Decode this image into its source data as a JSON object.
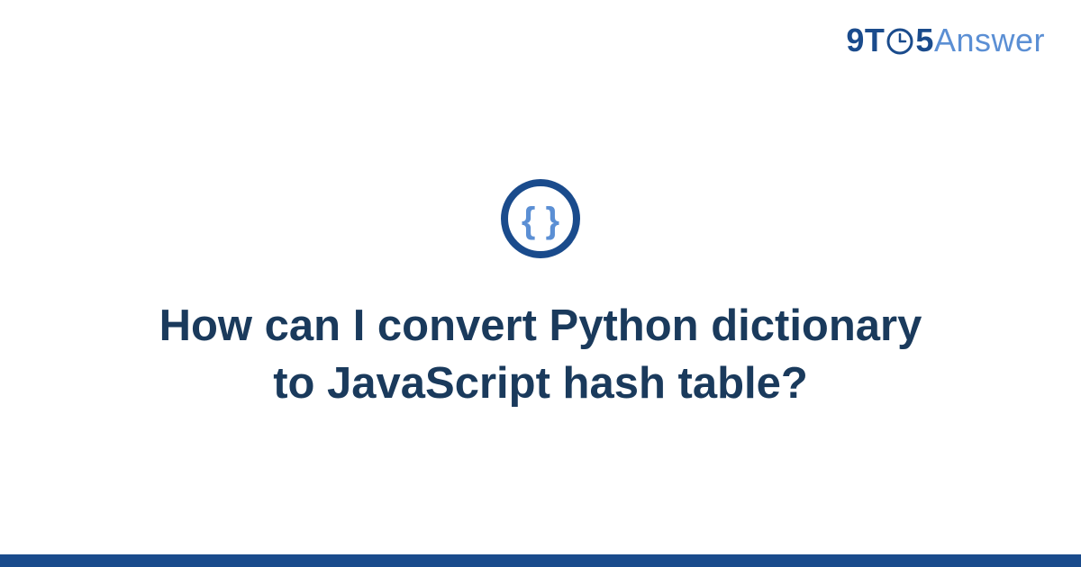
{
  "logo": {
    "prefix": "9T",
    "suffix": "5",
    "word": "Answer"
  },
  "icon": {
    "name": "code-braces-icon",
    "color_ring": "#1a4b8c",
    "color_braces": "#5b8fd4"
  },
  "question": {
    "title": "How can I convert Python dictionary to JavaScript hash table?"
  },
  "colors": {
    "brand_dark": "#1a4b8c",
    "brand_light": "#5b8fd4",
    "heading": "#1a3a5c"
  }
}
